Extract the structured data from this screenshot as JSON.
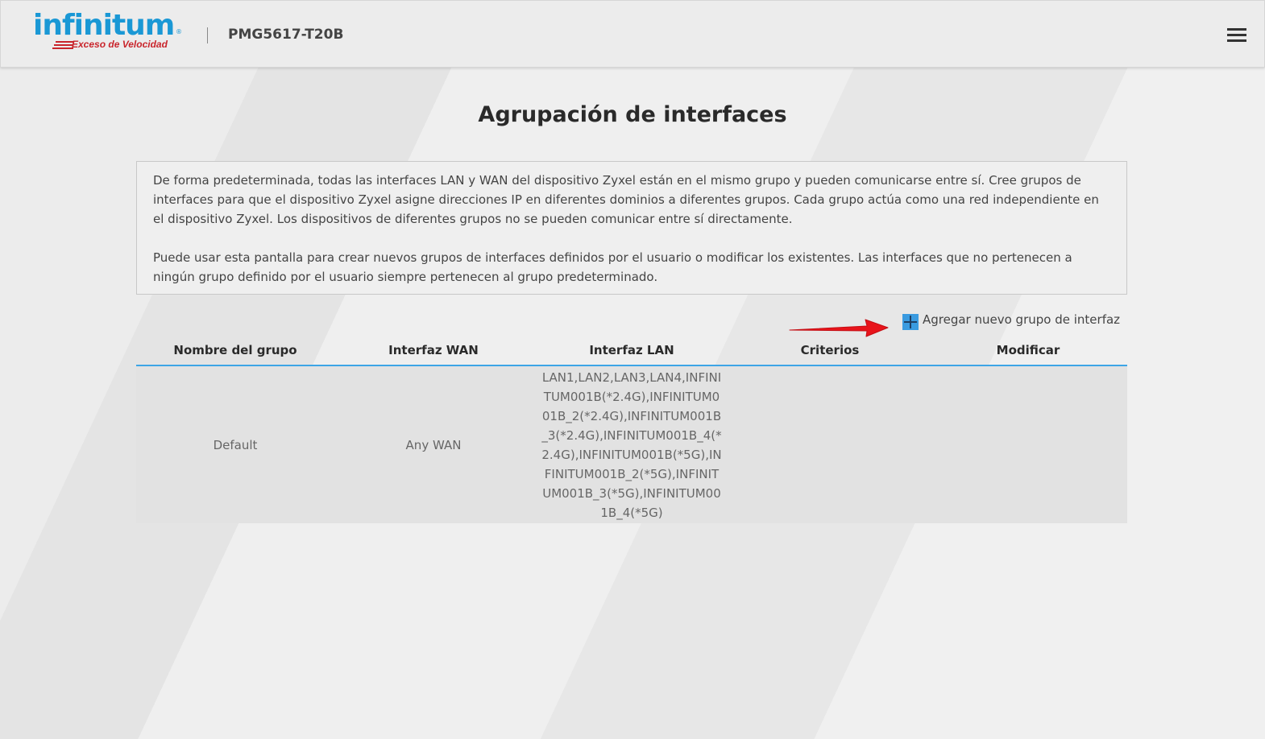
{
  "header": {
    "logo": {
      "word": "infinitum",
      "registered": "®",
      "tagline": "Exceso de Velocidad"
    },
    "model": "PMG5617-T20B",
    "menu_icon": "hamburger-menu-icon"
  },
  "page": {
    "title": "Agrupación de interfaces",
    "description": [
      "De forma predeterminada, todas las interfaces LAN y WAN del dispositivo Zyxel están en el mismo grupo y pueden comunicarse entre sí. Cree grupos de interfaces para que el dispositivo Zyxel asigne direcciones IP en diferentes dominios a diferentes grupos. Cada grupo actúa como una red independiente en el dispositivo Zyxel. Los dispositivos de diferentes grupos no se pueden comunicar entre sí directamente.",
      "Puede usar esta pantalla para crear nuevos grupos de interfaces definidos por el usuario o modificar los existentes. Las interfaces que no pertenecen a ningún grupo definido por el usuario siempre pertenecen al grupo predeterminado."
    ],
    "add_group": {
      "icon": "plus-icon",
      "label": "Agregar nuevo grupo de interfaz"
    },
    "annotation": {
      "icon": "red-arrow-icon",
      "color": "#e8141b"
    }
  },
  "table": {
    "headers": [
      "Nombre del grupo",
      "Interfaz WAN",
      "Interfaz LAN",
      "Criterios",
      "Modificar"
    ],
    "rows": [
      {
        "name": "Default",
        "wan": "Any WAN",
        "lan": "LAN1,LAN2,LAN3,LAN4,INFINITUM001B(*2.4G),INFINITUM001B_2(*2.4G),INFINITUM001B_3(*2.4G),INFINITUM001B_4(*2.4G),INFINITUM001B(*5G),INFINITUM001B_2(*5G),INFINITUM001B_3(*5G),INFINITUM001B_4(*5G)",
        "criteria": "",
        "modify": ""
      }
    ]
  },
  "colors": {
    "brand_blue": "#1a98d5",
    "brand_red": "#c9252c",
    "accent_line": "#3da5e6"
  }
}
